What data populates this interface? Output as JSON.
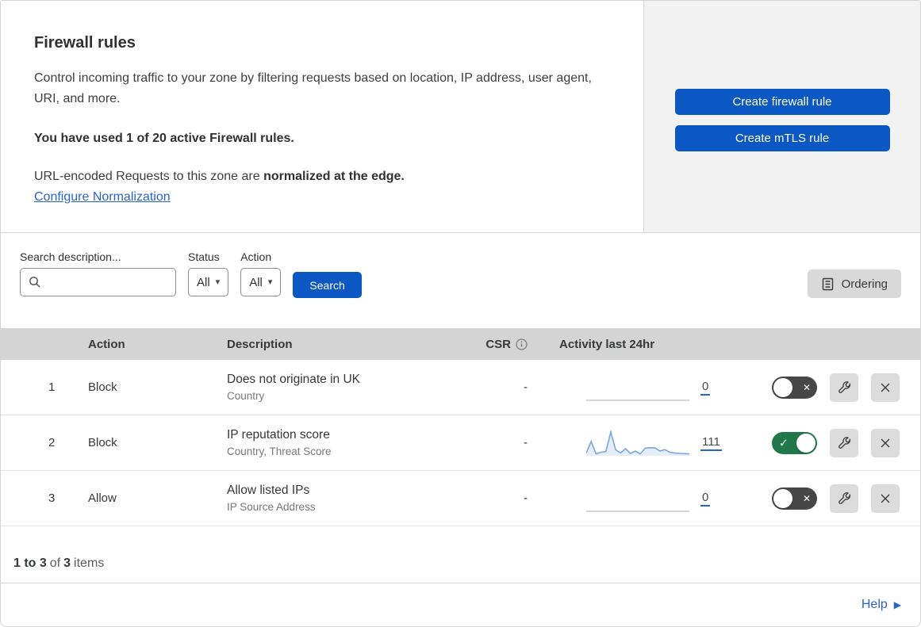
{
  "colors": {
    "accent_blue": "#0b57c4",
    "link_blue": "#2864c8",
    "toggle_on_green": "#20784a",
    "toggle_off_gray": "#474747",
    "header_gray": "#d4d4d4",
    "panel_gray": "#f2f2f2",
    "button_gray": "#dcdcdc",
    "sparkline_blue": "#7aa7dd"
  },
  "intro": {
    "title": "Firewall rules",
    "description": "Control incoming traffic to your zone by filtering requests based on location, IP address, user agent, URI, and more.",
    "usage": "You have used 1 of 20 active Firewall rules.",
    "normalization_prefix": "URL-encoded Requests to this zone are",
    "normalization_bold": "normalized at the edge.",
    "normalization_link": "Configure Normalization"
  },
  "actions": {
    "create_firewall_rule": "Create firewall rule",
    "create_mtls_rule": "Create mTLS rule"
  },
  "filters": {
    "search_label": "Search description...",
    "status_label": "Status",
    "status_value": "All",
    "action_label": "Action",
    "action_value": "All",
    "search_button": "Search",
    "ordering_button": "Ordering"
  },
  "table": {
    "columns": {
      "action": "Action",
      "description": "Description",
      "csr": "CSR",
      "activity": "Activity last 24hr"
    },
    "rows": [
      {
        "priority": "1",
        "action": "Block",
        "description": "Does not originate in UK",
        "fields": "Country",
        "csr": "-",
        "activity_count": "0",
        "enabled": false,
        "sparkline": []
      },
      {
        "priority": "2",
        "action": "Block",
        "description": "IP reputation score",
        "fields": "Country, Threat Score",
        "csr": "-",
        "activity_count": "111",
        "enabled": true,
        "sparkline": [
          12,
          60,
          8,
          15,
          18,
          100,
          25,
          12,
          30,
          10,
          20,
          8,
          32,
          34,
          33,
          20,
          26,
          15,
          12,
          10,
          9,
          8
        ]
      },
      {
        "priority": "3",
        "action": "Allow",
        "description": "Allow listed IPs",
        "fields": "IP Source Address",
        "csr": "-",
        "activity_count": "0",
        "enabled": false,
        "sparkline": []
      }
    ]
  },
  "footer": {
    "range": "1 to 3",
    "of": "of",
    "total": "3",
    "items_label": "items",
    "help": "Help"
  }
}
